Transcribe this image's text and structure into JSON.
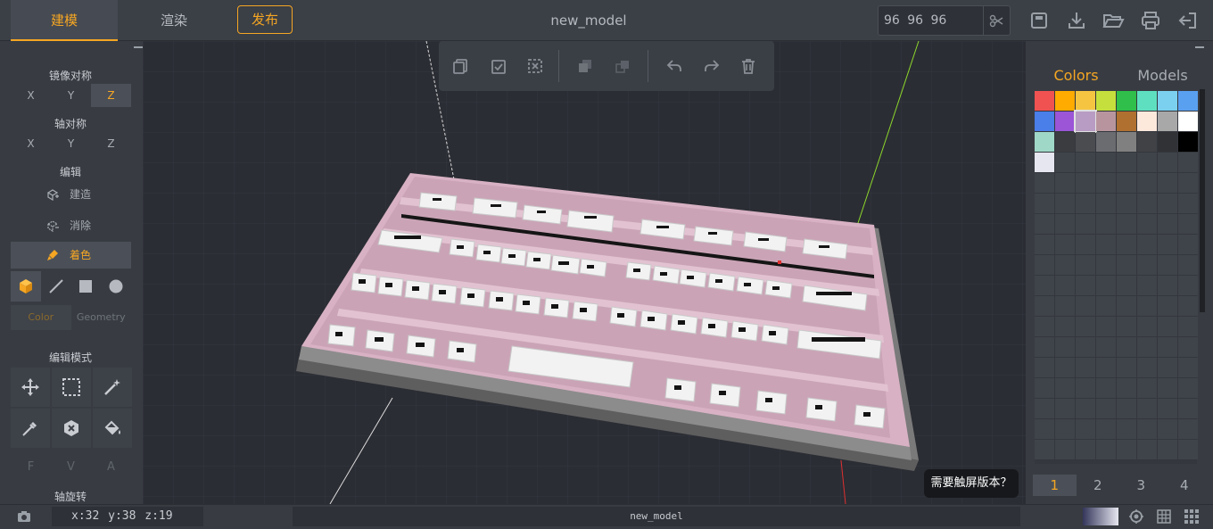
{
  "topbar": {
    "tab_model": "建模",
    "tab_render": "渲染",
    "publish": "发布",
    "title": "new_model",
    "dims_value": "96 96 96"
  },
  "left": {
    "mirror_title": "镜像对称",
    "mirror_axes": [
      "X",
      "Y",
      "Z"
    ],
    "axis_sym_title": "轴对称",
    "axis_sym_axes": [
      "X",
      "Y",
      "Z"
    ],
    "edit_title": "编辑",
    "build_label": "建造",
    "erase_label": "消除",
    "paint_label": "着色",
    "color_tab": "Color",
    "geometry_tab": "Geometry",
    "edit_mode_title": "编辑模式",
    "fva": [
      "F",
      "V",
      "A"
    ],
    "axis_rotate_title": "轴旋转"
  },
  "viewport": {
    "touch_tip": "需要触屏版本？"
  },
  "right": {
    "tab_colors": "Colors",
    "tab_models": "Models",
    "pages": [
      "1",
      "2",
      "3",
      "4"
    ],
    "swatches": [
      "#f05252",
      "#ffab00",
      "#f5c542",
      "#c5e03c",
      "#2fbf4a",
      "#5ee0c0",
      "#7cd0ef",
      "#5aa0f0",
      "#4a7ee8",
      "#9b55d6",
      "#b89cc4",
      "#b8959e",
      "#b07030",
      "#fde8dc",
      "#a8a8a8",
      "#ffffff",
      "#a0d8c8",
      "#3a3c40",
      "#4a4c50",
      "#6a6c70",
      "#808080",
      "#404246",
      "#303236",
      "#000000",
      "#e6e6f0"
    ]
  },
  "status": {
    "coords": "x:32 y:38 z:19",
    "model_name": "new_model"
  }
}
